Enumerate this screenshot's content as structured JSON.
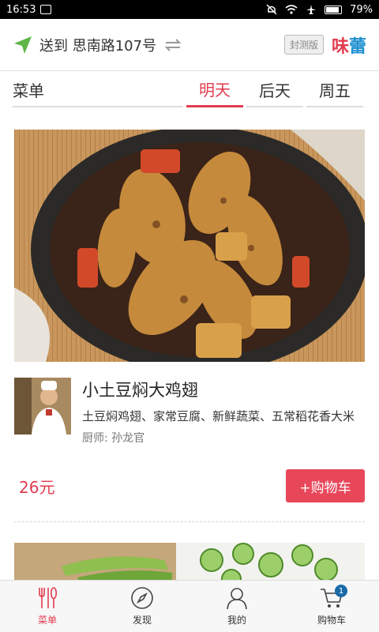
{
  "statusbar": {
    "time": "16:53",
    "battery": "79%"
  },
  "header": {
    "address": "送到 思南路107号",
    "beta": "封测版",
    "brand_part1": "味",
    "brand_part2": "蕾"
  },
  "tabs": {
    "menu_label": "菜单",
    "items": [
      "明天",
      "后天",
      "周五"
    ],
    "active": 0
  },
  "dish": {
    "name": "小土豆焖大鸡翅",
    "description": "土豆焖鸡翅、家常豆腐、新鲜蔬菜、五常稻花香大米",
    "chef": "厨师: 孙龙官",
    "price": "26元",
    "cart_button": "+购物车"
  },
  "bottomnav": {
    "items": [
      {
        "label": "菜单",
        "icon": "fork-knife-icon"
      },
      {
        "label": "发现",
        "icon": "compass-icon"
      },
      {
        "label": "我的",
        "icon": "user-icon"
      },
      {
        "label": "购物车",
        "icon": "cart-icon"
      }
    ],
    "cart_count": "1"
  },
  "colors": {
    "accent": "#e23b4f",
    "brand_blue": "#1e8fd0",
    "badge": "#1a6aa6"
  }
}
